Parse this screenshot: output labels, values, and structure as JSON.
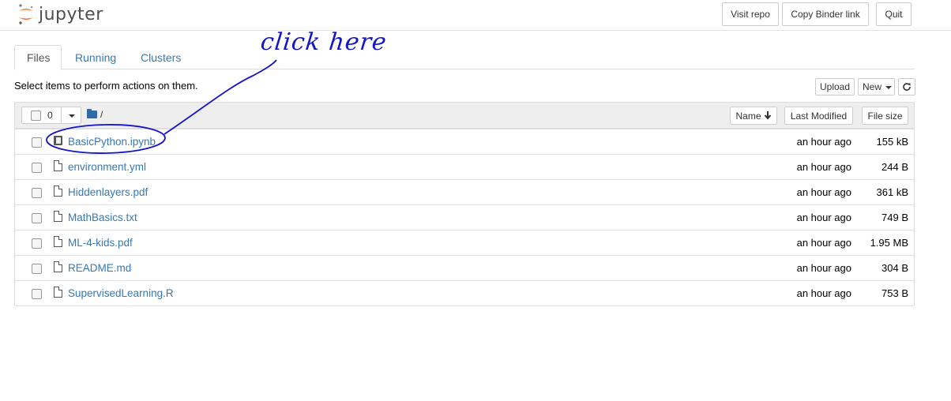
{
  "app": {
    "logo_text": "jupyter",
    "brand_color": "#f37726"
  },
  "header": {
    "visit_repo": "Visit repo",
    "copy_binder": "Copy Binder link",
    "quit": "Quit"
  },
  "tabs": [
    {
      "label": "Files",
      "active": true
    },
    {
      "label": "Running",
      "active": false
    },
    {
      "label": "Clusters",
      "active": false
    }
  ],
  "toolbar": {
    "hint": "Select items to perform actions on them.",
    "upload": "Upload",
    "new": "New",
    "refresh_icon": "refresh-icon"
  },
  "list": {
    "selected_count": "0",
    "path": "/",
    "columns": {
      "name": "Name",
      "last_modified": "Last Modified",
      "file_size": "File size"
    },
    "files": [
      {
        "name": "BasicPython.ipynb",
        "modified": "an hour ago",
        "size": "155 kB",
        "icon": "notebook-icon"
      },
      {
        "name": "environment.yml",
        "modified": "an hour ago",
        "size": "244 B",
        "icon": "file-icon"
      },
      {
        "name": "Hiddenlayers.pdf",
        "modified": "an hour ago",
        "size": "361 kB",
        "icon": "file-icon"
      },
      {
        "name": "MathBasics.txt",
        "modified": "an hour ago",
        "size": "749 B",
        "icon": "file-icon"
      },
      {
        "name": "ML-4-kids.pdf",
        "modified": "an hour ago",
        "size": "1.95 MB",
        "icon": "file-icon"
      },
      {
        "name": "README.md",
        "modified": "an hour ago",
        "size": "304 B",
        "icon": "file-icon"
      },
      {
        "name": "SupervisedLearning.R",
        "modified": "an hour ago",
        "size": "753 B",
        "icon": "file-icon"
      }
    ]
  },
  "annotation": {
    "text": "click here",
    "color": "#1515c8"
  }
}
